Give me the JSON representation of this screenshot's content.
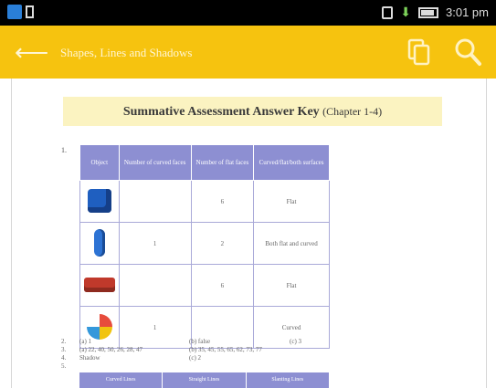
{
  "status_bar": {
    "time": "3:01 pm",
    "icons": [
      "app-icon",
      "sd-card-icon",
      "vibrate-icon",
      "download-icon",
      "battery-icon"
    ]
  },
  "app_bar": {
    "title": "Shapes, Lines and Shadows",
    "back_icon": "back-arrow-icon",
    "actions": [
      "copy-icon",
      "search-icon"
    ],
    "color": "#f6c30f"
  },
  "document": {
    "heading": "Summative Assessment Answer Key",
    "heading_sub": "(Chapter 1-4)",
    "question_1": "1.",
    "table": {
      "headers": [
        "Object",
        "Number of curved faces",
        "Number of flat faces",
        "Curved/flat/both surfaces"
      ],
      "rows": [
        {
          "icon": "cube-icon",
          "curved": "",
          "flat": "6",
          "surface": "Flat"
        },
        {
          "icon": "cylinder-icon",
          "curved": "1",
          "flat": "2",
          "surface": "Both flat and curved"
        },
        {
          "icon": "brick-icon",
          "curved": "",
          "flat": "6",
          "surface": "Flat"
        },
        {
          "icon": "ball-icon",
          "curved": "1",
          "flat": "",
          "surface": "Curved"
        }
      ]
    },
    "answers": [
      {
        "num": "2.",
        "a": "(a) 1",
        "b": "(b) false",
        "c": "(c) 3"
      },
      {
        "num": "3.",
        "a": "(a) 22, 40, 50, 26, 28, 47",
        "b": "(b) 35, 45, 55, 65, 62, 73, 77",
        "c": ""
      },
      {
        "num": "4.",
        "a": "Shadow",
        "b": "(c) 2",
        "c": ""
      },
      {
        "num": "5.",
        "a": "",
        "b": "",
        "c": ""
      }
    ],
    "bottom_headers": [
      "Curved Lines",
      "Straight Lines",
      "Slanting Lines"
    ],
    "accent": "#8d8fd2",
    "heading_bg": "#fbf3c1"
  }
}
